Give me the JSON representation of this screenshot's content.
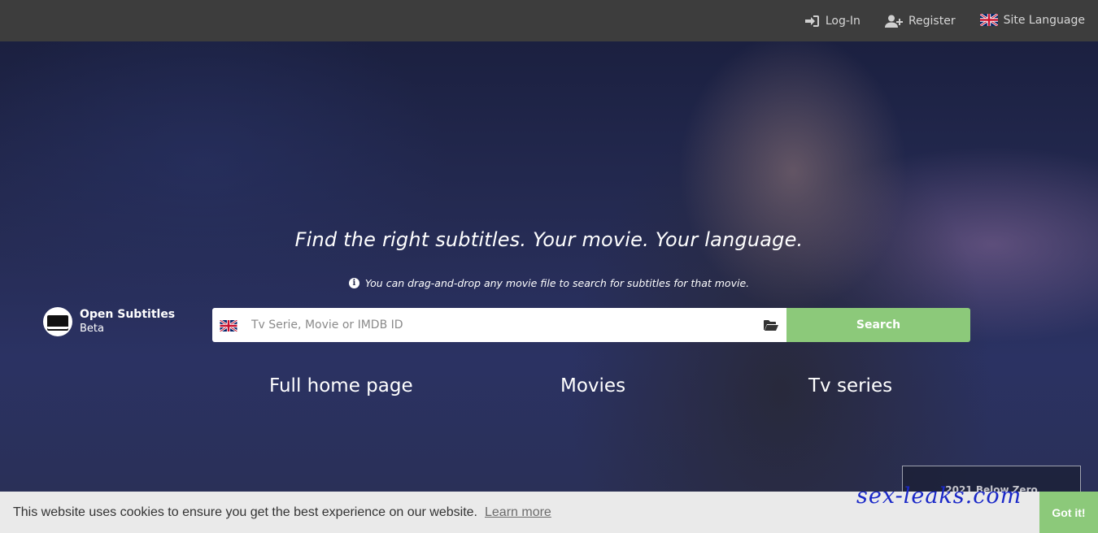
{
  "header": {
    "login_label": "Log-In",
    "register_label": "Register",
    "language_label": "Site Language"
  },
  "hero": {
    "title": "Find the right subtitles. Your movie. Your language.",
    "hint": "You can drag-and-drop any movie file to search for subtitles for that movie."
  },
  "logo": {
    "name": "Open Subtitles",
    "badge": "Beta"
  },
  "search": {
    "placeholder": "Tv Serie, Movie or IMDB ID",
    "value": "",
    "button_label": "Search",
    "language_flag": "uk-flag-icon"
  },
  "nav": {
    "full_home": "Full home page",
    "movies": "Movies",
    "tv_series": "Tv series"
  },
  "featured": {
    "title": "2021 Below Zero"
  },
  "cookie": {
    "message": "This website uses cookies to ensure you get the best experience on our website.",
    "learn_more": "Learn more",
    "accept": "Got it!"
  },
  "watermark": "sex-leaks.com",
  "colors": {
    "topbar": "#3d3d3d",
    "accent_green": "#8cc97a",
    "cookie_bg": "#eaeaea",
    "watermark": "#1a28c8"
  }
}
